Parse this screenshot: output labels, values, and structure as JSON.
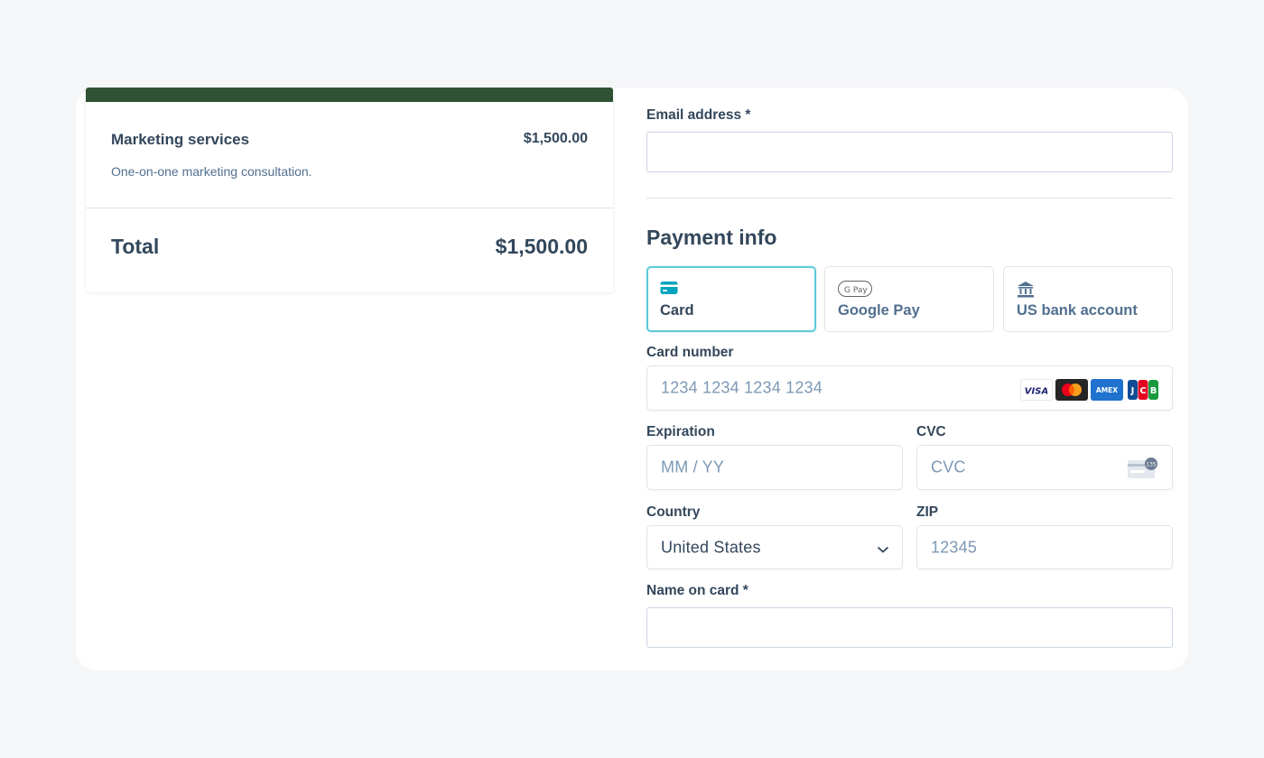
{
  "summary": {
    "item_name": "Marketing services",
    "item_price": "$1,500.00",
    "item_description": "One-on-one marketing consultation.",
    "total_label": "Total",
    "total_value": "$1,500.00"
  },
  "form": {
    "email_label": "Email address *",
    "email_value": "",
    "section_title": "Payment info",
    "tabs": [
      {
        "label": "Card",
        "icon": "credit-card-icon",
        "selected": true
      },
      {
        "label": "Google Pay",
        "icon": "google-pay-icon",
        "selected": false
      },
      {
        "label": "US bank account",
        "icon": "bank-icon",
        "selected": false
      }
    ],
    "card_number_label": "Card number",
    "card_number_placeholder": "1234 1234 1234 1234",
    "card_brands": [
      "VISA",
      "mastercard",
      "AMEX",
      "JCB"
    ],
    "expiration_label": "Expiration",
    "expiration_placeholder": "MM / YY",
    "cvc_label": "CVC",
    "cvc_placeholder": "CVC",
    "cvc_icon_text": "135",
    "country_label": "Country",
    "country_value": "United States",
    "zip_label": "ZIP",
    "zip_placeholder": "12345",
    "name_label": "Name on card *",
    "name_value": ""
  },
  "colors": {
    "accent_bar": "#2e5233",
    "active_tab_border": "#5fc9d8",
    "card_icon": "#00a4bd",
    "text": "#33475b"
  }
}
